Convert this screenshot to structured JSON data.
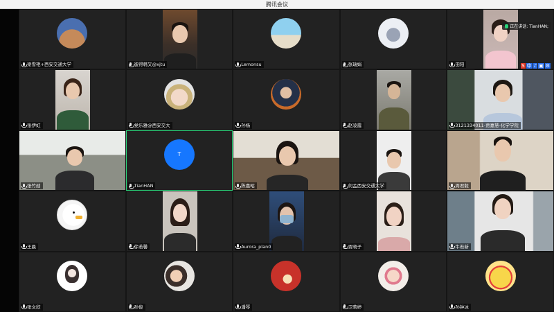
{
  "window": {
    "title": "腾讯会议"
  },
  "speaker": {
    "label": "正在讲话: TianHAN;"
  },
  "tray": {
    "icons": [
      "S",
      "中",
      "♪",
      "▣",
      "⚙"
    ]
  },
  "participants": [
    {
      "name": "梁雪艳+西安交通大学"
    },
    {
      "name": "彼得韩又@xjtu"
    },
    {
      "name": "Lemonsu"
    },
    {
      "name": "张瑞娟"
    },
    {
      "name": "田阳"
    },
    {
      "name": "张伊虹"
    },
    {
      "name": "党乐雅@西安交大"
    },
    {
      "name": "孙杨"
    },
    {
      "name": "赵凌霞"
    },
    {
      "name": "3121334011-贾嘉慧-化学学院"
    },
    {
      "name": "张竹勋"
    },
    {
      "name": "TianHAN",
      "initial": "T"
    },
    {
      "name": "陈嘉昭"
    },
    {
      "name": "何孟西安交通大学"
    },
    {
      "name": "周君毅"
    },
    {
      "name": "王晨"
    },
    {
      "name": "徐若馨"
    },
    {
      "name": "Aurora_plan0"
    },
    {
      "name": "贾晓子"
    },
    {
      "name": "牛若新"
    },
    {
      "name": "张文欣"
    },
    {
      "name": "孙俊"
    },
    {
      "name": "潘琴"
    },
    {
      "name": "卫莉婷"
    },
    {
      "name": "孙钟冰"
    }
  ]
}
